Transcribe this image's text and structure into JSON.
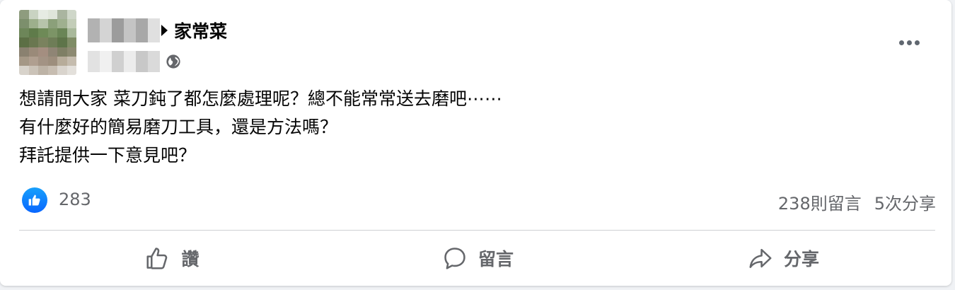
{
  "post": {
    "group_name": "家常菜",
    "text_lines": [
      "想請問大家 菜刀鈍了都怎麼處理呢？總不能常常送去磨吧⋯⋯",
      "有什麼好的簡易磨刀工具，還是方法嗎？",
      "拜託提供一下意見吧？"
    ],
    "privacy_icon": "globe-icon",
    "more_icon": "more-options-icon"
  },
  "stats": {
    "like_count": "283",
    "comments": "238則留言",
    "shares": "5次分享"
  },
  "actions": {
    "like_label": "讚",
    "comment_label": "留言",
    "share_label": "分享"
  },
  "colors": {
    "accent": "#0866ff",
    "secondary_text": "#65676b",
    "primary_text": "#050505",
    "divider": "#ced0d4"
  }
}
